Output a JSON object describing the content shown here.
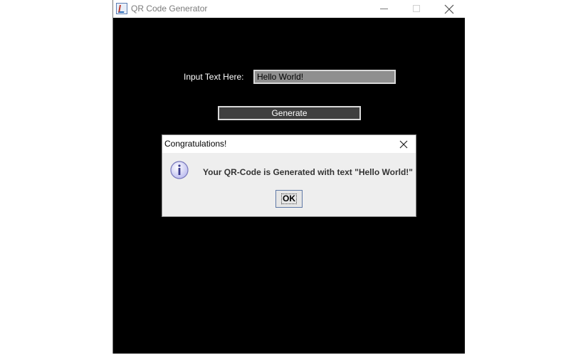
{
  "window": {
    "title": "QR Code Generator"
  },
  "form": {
    "input_label": "Input Text Here:",
    "input_value": "Hello World!",
    "generate_label": "Generate"
  },
  "dialog": {
    "title": "Congratulations!",
    "message": "Your QR-Code is Generated with text \"Hello World!\"",
    "ok_label": "OK",
    "icon": "info-icon"
  },
  "colors": {
    "window_bg": "#000000",
    "dialog_bg": "#eeeeee",
    "input_bg": "#8f8f8f",
    "button_bg": "#3f3f3f"
  }
}
